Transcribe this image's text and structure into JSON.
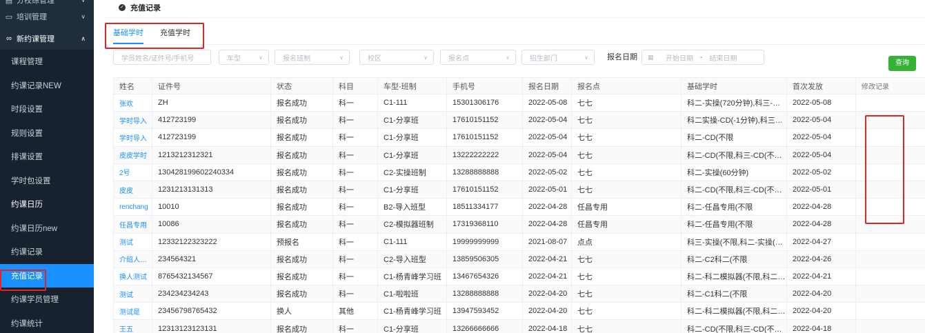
{
  "sidebar": {
    "groups": [
      {
        "label": "分校综管理",
        "icon": "layers-icon"
      },
      {
        "label": "培训管理",
        "icon": "chat-icon"
      },
      {
        "label": "新约课管理",
        "icon": "link-icon"
      }
    ],
    "items": [
      {
        "label": "课程管理"
      },
      {
        "label": "约课记录NEW"
      },
      {
        "label": "时段设置"
      },
      {
        "label": "规则设置"
      },
      {
        "label": "排课设置"
      },
      {
        "label": "学时包设置"
      },
      {
        "label": "约课日历"
      },
      {
        "label": "约课日历new"
      },
      {
        "label": "约课记录"
      },
      {
        "label": "充值记录"
      },
      {
        "label": "约课学员管理"
      },
      {
        "label": "约课统计"
      }
    ]
  },
  "page": {
    "title": "充值记录"
  },
  "tabs": [
    {
      "label": "基础学时"
    },
    {
      "label": "充值学时"
    }
  ],
  "filters": {
    "student": "学员姓名/证件号/手机号",
    "car_type": "车型",
    "class_type": "报名班制",
    "campus": "校区",
    "signup_point": "报名点",
    "department": "招生部门",
    "date_label": "报名日期",
    "start_date": "开始日期",
    "date_sep": "-",
    "end_date": "结束日期",
    "query": "查询"
  },
  "table": {
    "columns": [
      "姓名",
      "证件号",
      "状态",
      "科目",
      "车型-班制",
      "手机号",
      "报名日期",
      "报名点",
      "基础学时",
      "首次发放",
      "修改记录"
    ],
    "rows": [
      {
        "name": "张欢",
        "id": "ZH",
        "status": "报名成功",
        "subject": "科一",
        "car": "C1-111",
        "phone": "15301306176",
        "date": "2022-05-08",
        "point": "七七",
        "hours": "科二-实操(720分钟),科三-实操...",
        "first": "2022-05-08",
        "log": ""
      },
      {
        "name": "学时导入",
        "id": "412723199",
        "status": "报名成功",
        "subject": "科一",
        "car": "C1-分享班",
        "phone": "17610151152",
        "date": "2022-05-04",
        "point": "七七",
        "hours": "科二实操-CD(-1分钟),科三实...",
        "first": "2022-05-04",
        "log": ""
      },
      {
        "name": "学时导入",
        "id": "412723199",
        "status": "报名成功",
        "subject": "科一",
        "car": "C1-分享班",
        "phone": "17610151152",
        "date": "2022-05-04",
        "point": "七七",
        "hours": "科二-CD(不限",
        "first": "2022-05-04",
        "log": ""
      },
      {
        "name": "皮皮学时",
        "id": "1213212312321",
        "status": "报名成功",
        "subject": "科一",
        "car": "C1-分享班",
        "phone": "13222222222",
        "date": "2022-05-04",
        "point": "七七",
        "hours": "科二-CD(不限,科三-CD(不限,...",
        "first": "2022-05-04",
        "log": ""
      },
      {
        "name": "2号",
        "id": "130428199602240334",
        "status": "报名成功",
        "subject": "科一",
        "car": "C2-实操班制",
        "phone": "13288888888",
        "date": "2022-05-02",
        "point": "七七",
        "hours": "科二-实操(60分钟)",
        "first": "2022-05-02",
        "log": ""
      },
      {
        "name": "皮皮",
        "id": "1231213131313",
        "status": "报名成功",
        "subject": "科一",
        "car": "C1-分享班",
        "phone": "17610151152",
        "date": "2022-05-01",
        "point": "七七",
        "hours": "科二-CD(不限,科三-CD(不限,...",
        "first": "2022-05-01",
        "log": ""
      },
      {
        "name": "renchang",
        "id": "10010",
        "status": "报名成功",
        "subject": "科一",
        "car": "B2-导入班型",
        "phone": "18511334177",
        "date": "2022-04-28",
        "point": "任昌专用",
        "hours": "科二-任昌专用(不限",
        "first": "2022-04-28",
        "log": ""
      },
      {
        "name": "任昌专用",
        "id": "10086",
        "status": "报名成功",
        "subject": "科一",
        "car": "C2-模拟器班制",
        "phone": "17319368110",
        "date": "2022-04-28",
        "point": "任昌专用",
        "hours": "科二-任昌专用(不限",
        "first": "2022-04-28",
        "log": ""
      },
      {
        "name": "测试",
        "id": "12332122323222",
        "status": "预报名",
        "subject": "科一",
        "car": "C1-111",
        "phone": "19999999999",
        "date": "2021-08-07",
        "point": "点点",
        "hours": "科三-实操(不限,科二-实操(不...",
        "first": "2022-04-27",
        "log": ""
      },
      {
        "name": "介绍人分教授",
        "id": "234564321",
        "status": "报名成功",
        "subject": "科一",
        "car": "C2-导入班型",
        "phone": "13859506305",
        "date": "2022-04-21",
        "point": "七七",
        "hours": "科二-C2科二(不限",
        "first": "2022-04-26",
        "log": ""
      },
      {
        "name": "换人测试",
        "id": "8765432134567",
        "status": "报名成功",
        "subject": "科一",
        "car": "C1-杨青峰学习班",
        "phone": "13467654326",
        "date": "2022-04-21",
        "point": "七七",
        "hours": "科二-科二模拟器(不限,科二-实...",
        "first": "2022-04-21",
        "log": ""
      },
      {
        "name": "测试",
        "id": "234234234243",
        "status": "报名成功",
        "subject": "科一",
        "car": "C1-啦啦班",
        "phone": "13288888888",
        "date": "2022-04-20",
        "point": "七七",
        "hours": "科二-C1科二(不限",
        "first": "2022-04-20",
        "log": ""
      },
      {
        "name": "测试是",
        "id": "23456798765432",
        "status": "换人",
        "subject": "其他",
        "car": "C1-杨青峰学习班",
        "phone": "13947593452",
        "date": "2022-04-20",
        "point": "七七",
        "hours": "科二-科二模拟器(不限,科二-实...",
        "first": "2022-04-20",
        "log": ""
      },
      {
        "name": "王五",
        "id": "12313123123131",
        "status": "报名成功",
        "subject": "科一",
        "car": "C1-分享班",
        "phone": "13266666666",
        "date": "2022-04-18",
        "point": "七七",
        "hours": "科二-CD(不限,科三-CD(不限,...",
        "first": "2022-04-18",
        "log": ""
      }
    ]
  },
  "colors": {
    "sidebar_bg": "#1f2d3d",
    "active": "#1890ff",
    "query_btn": "#35b233",
    "highlight": "#e02424"
  }
}
